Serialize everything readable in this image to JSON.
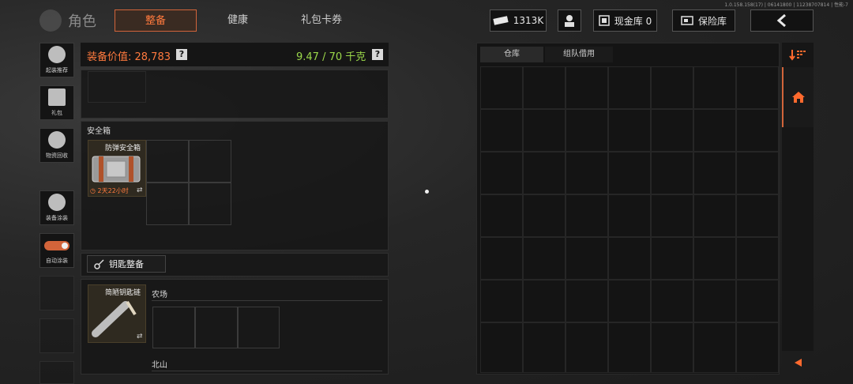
{
  "version_text": "1.0.158.158(17) | 06141800 | 11238707814 | 性能-7",
  "header": {
    "title": "角色",
    "tabs": [
      {
        "label": "整备",
        "active": true
      },
      {
        "label": "健康",
        "active": false
      },
      {
        "label": "礼包卡券",
        "active": false
      }
    ],
    "currency": "1313K",
    "cash_vault": "现金库 0",
    "safe_vault": "保险库"
  },
  "sidebar": {
    "items": [
      {
        "label": "起装推荐",
        "icon": "gear-hand-icon"
      },
      {
        "label": "礼包",
        "icon": "gift-icon"
      },
      {
        "label": "物资回收",
        "icon": "recycle-icon"
      },
      {
        "label": "装备涂装",
        "icon": "paint-helmet-icon"
      },
      {
        "label": "自动涂装",
        "icon": "toggle-icon"
      }
    ]
  },
  "loadout": {
    "value_label": "装备价值: 28,783",
    "weight_label": "9.47 / 70 千克",
    "help": "?",
    "safe_box_section": "安全箱",
    "safe_box_item": {
      "name": "防弹安全箱",
      "timer": "2天22小时",
      "swap_symbol": "⇄"
    },
    "key_section": "钥匙整备",
    "key_item": {
      "name": "简陋钥匙链",
      "swap_symbol": "⇄"
    },
    "key_areas": [
      "农场",
      "北山"
    ]
  },
  "warehouse": {
    "tabs": [
      {
        "label": "仓库",
        "active": true
      },
      {
        "label": "组队借用",
        "active": false
      }
    ]
  },
  "colors": {
    "accent": "#ff7a3e",
    "weight_ok": "#9bd84a"
  }
}
